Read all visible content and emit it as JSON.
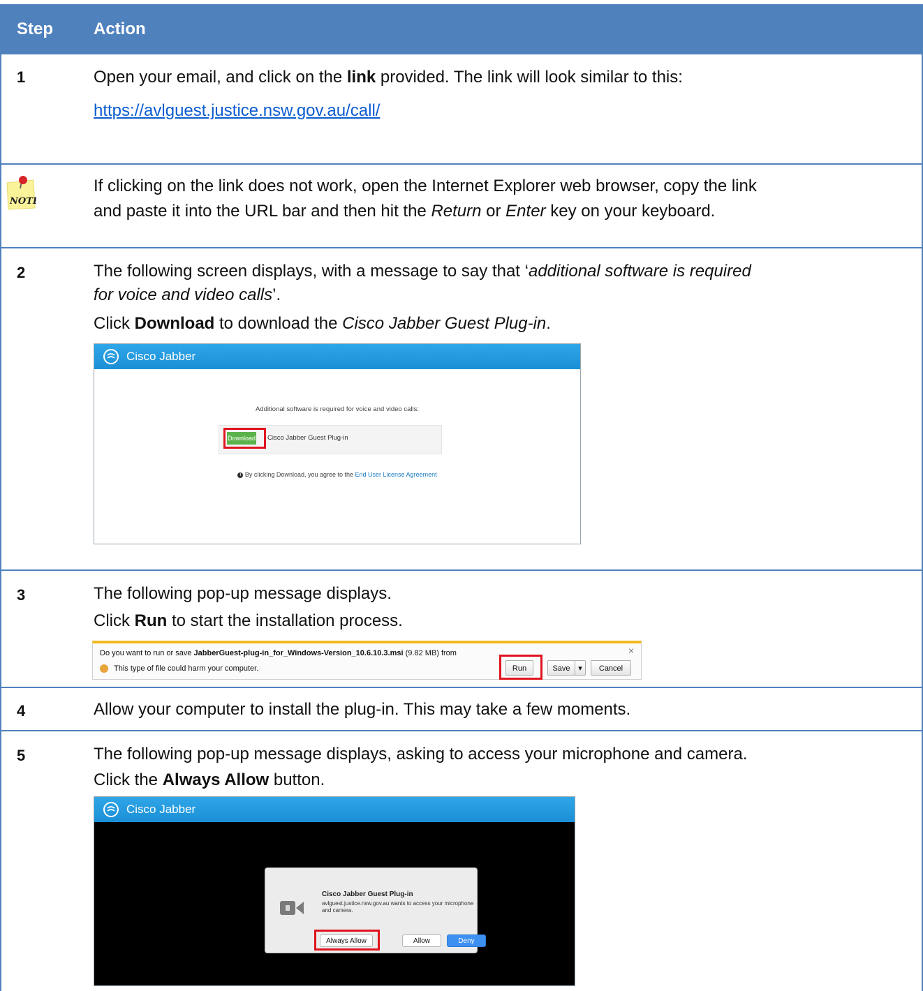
{
  "header": {
    "step_label": "Step",
    "action_label": "Action"
  },
  "step1": {
    "num": "1",
    "text_pre": "Open your email, and click on the ",
    "text_bold": "link",
    "text_post": " provided. The link will look similar to this:",
    "link": "https://avlguest.justice.nsw.gov.au/call/"
  },
  "note": {
    "icon_text": "NOTE",
    "line1": "If clicking on the link does not work, open the Internet Explorer web browser, copy the link",
    "line2_pre": "and paste it into the URL bar and then hit the ",
    "line2_i1": "Return",
    "line2_mid": " or ",
    "line2_i2": "Enter",
    "line2_post": " key on your keyboard."
  },
  "step2": {
    "num": "2",
    "line1_pre": "The following screen displays, with a message to say that ‘",
    "line1_i": "additional software is required",
    "line2_i": "for voice and video calls",
    "line2_post": "’.",
    "line3_pre": "Click ",
    "line3_bold": "Download",
    "line3_mid": " to download the ",
    "line3_i": "Cisco Jabber Guest Plug-in",
    "line3_post": ".",
    "window": {
      "title": "Cisco Jabber",
      "message": "Additional software is required for voice and video calls:",
      "button": "Download",
      "plugin": "Cisco Jabber Guest Plug-in",
      "agree_pre": "By clicking Download, you agree to the ",
      "agree_link": "End User License Agreement"
    }
  },
  "step3": {
    "num": "3",
    "line1": "The following pop-up message displays.",
    "line2_pre": "Click ",
    "line2_bold": "Run",
    "line2_post": " to start the installation process.",
    "ie": {
      "q_pre": "Do you want to run or save ",
      "q_file": "JabberGuest-plug-in_for_Windows-Version_10.6.10.3.msi",
      "q_post": " (9.82 MB) from",
      "warn": "This type of file could harm your computer.",
      "run": "Run",
      "save": "Save",
      "cancel": "Cancel",
      "close": "×"
    }
  },
  "step4": {
    "num": "4",
    "text": "Allow your computer to install the plug-in. This may take a few moments."
  },
  "step5": {
    "num": "5",
    "line1": "The following pop-up message displays, asking to access your microphone and camera.",
    "line2_pre": "Click the ",
    "line2_bold": "Always Allow",
    "line2_post": " button.",
    "window": {
      "title": "Cisco Jabber",
      "dlg_title": "Cisco Jabber Guest Plug-in",
      "dlg_msg1": "avlguest.justice.nsw.gov.au wants to access your microphone",
      "dlg_msg2": "and camera.",
      "always_allow": "Always Allow",
      "allow": "Allow",
      "deny": "Deny"
    }
  },
  "colors": {
    "header": "#4f81bd",
    "accent_red": "#e0141f",
    "download_green": "#5ab34a",
    "jabber_blue": "#1b8fd6"
  }
}
